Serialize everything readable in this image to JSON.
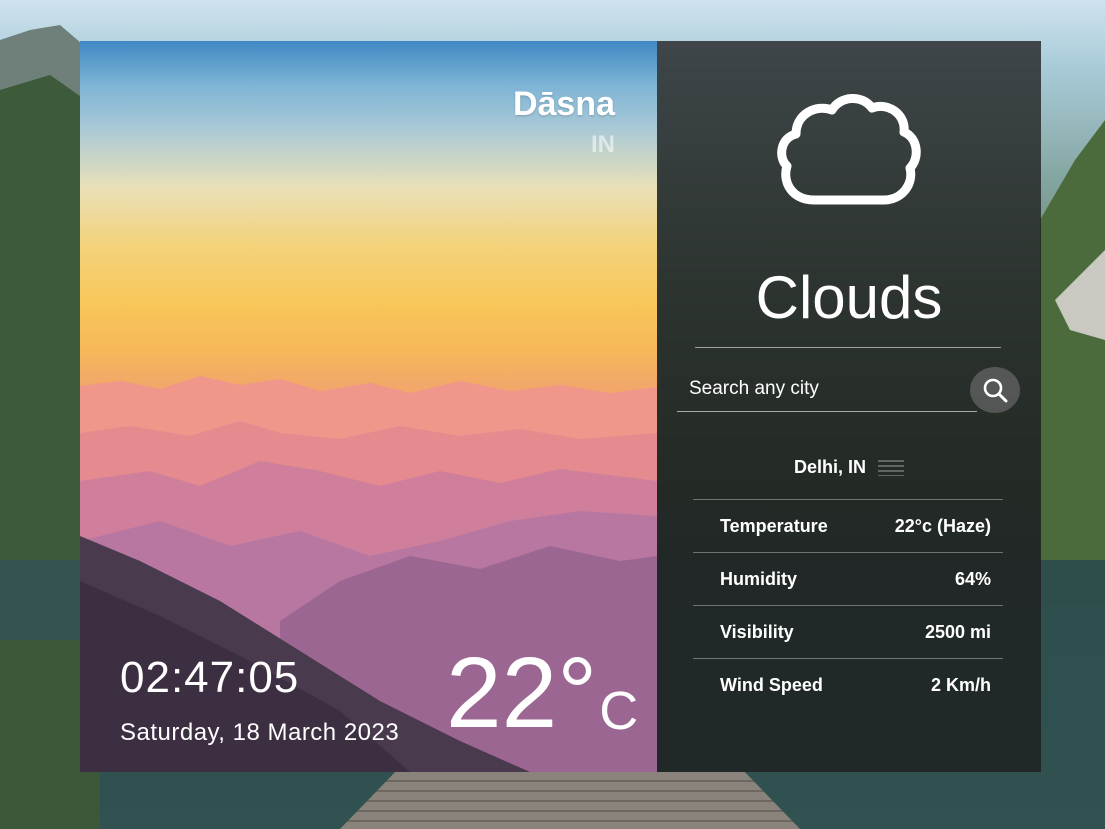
{
  "location": {
    "city": "Dāsna",
    "country": "IN"
  },
  "clock": {
    "time": "02:47:05",
    "date": "Saturday, 18 March 2023"
  },
  "current": {
    "temperature": "22°",
    "unit": "C",
    "condition": "Clouds",
    "icon": "cloud-icon"
  },
  "search": {
    "placeholder": "Search any city",
    "value": "",
    "button_icon": "search-icon"
  },
  "result": {
    "city": "Delhi, IN",
    "icon": "haze-icon",
    "stats": [
      {
        "label": "Temperature",
        "value": "22°c (Haze)"
      },
      {
        "label": "Humidity",
        "value": "64%"
      },
      {
        "label": "Visibility",
        "value": "2500 mi"
      },
      {
        "label": "Wind Speed",
        "value": "2 Km/h"
      }
    ]
  }
}
